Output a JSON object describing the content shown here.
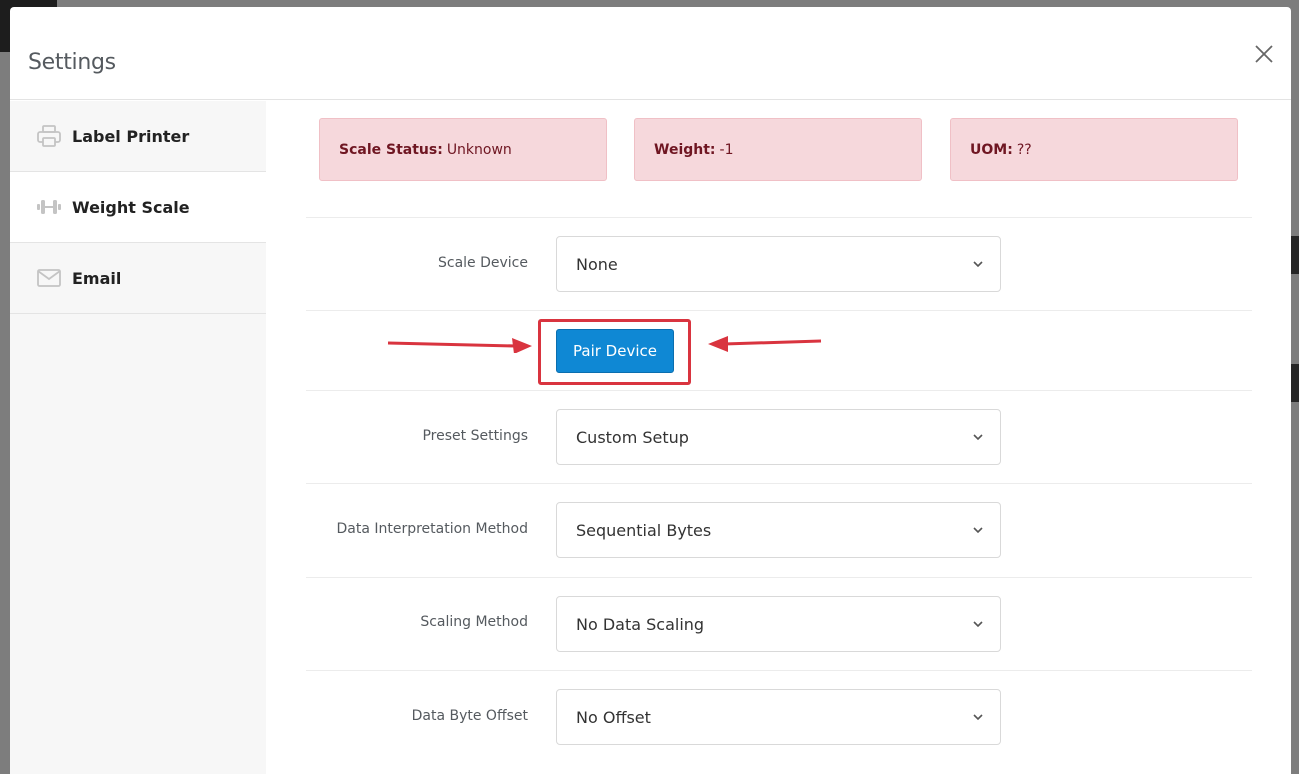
{
  "modal": {
    "title": "Settings"
  },
  "sidebar": {
    "items": [
      {
        "label": "Label Printer",
        "icon": "printer-icon",
        "active": false
      },
      {
        "label": "Weight Scale",
        "icon": "dumbbell-icon",
        "active": true
      },
      {
        "label": "Email",
        "icon": "envelope-icon",
        "active": false
      }
    ]
  },
  "status": {
    "scale_status_label": "Scale Status:",
    "scale_status_value": "Unknown",
    "weight_label": "Weight:",
    "weight_value": "-1",
    "uom_label": "UOM:",
    "uom_value": "??"
  },
  "form": {
    "scale_device": {
      "label": "Scale Device",
      "value": "None"
    },
    "pair_button": "Pair Device",
    "preset_settings": {
      "label": "Preset Settings",
      "value": "Custom Setup"
    },
    "data_interpretation": {
      "label": "Data Interpretation Method",
      "value": "Sequential Bytes"
    },
    "scaling_method": {
      "label": "Scaling Method",
      "value": "No Data Scaling"
    },
    "data_byte_offset": {
      "label": "Data Byte Offset",
      "value": "No Offset"
    }
  },
  "colors": {
    "alert_bg": "#f6d8dc",
    "alert_text": "#6f1622",
    "primary": "#0f88d4",
    "highlight": "#d9343f"
  }
}
